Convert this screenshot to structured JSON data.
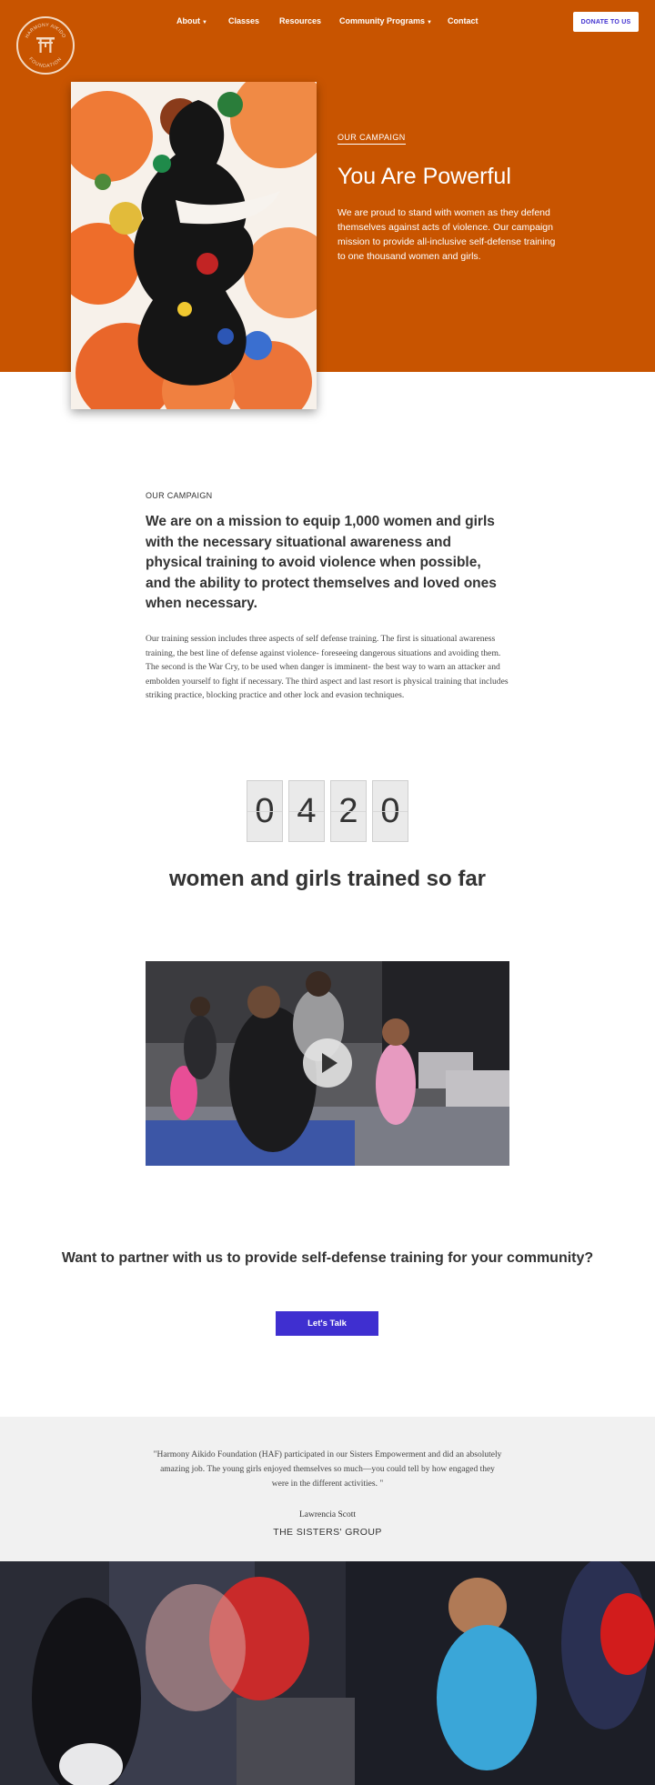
{
  "logo": {
    "text_top": "HARMONY AIKIDO",
    "text_bottom": "FOUNDATION"
  },
  "nav": {
    "items": [
      {
        "label": "About",
        "dropdown": true
      },
      {
        "label": "Classes",
        "dropdown": false
      },
      {
        "label": "Resources",
        "dropdown": false
      },
      {
        "label": "Community Programs",
        "dropdown": true
      },
      {
        "label": "Contact",
        "dropdown": false
      }
    ],
    "donate": "DONATE TO US"
  },
  "hero": {
    "eyebrow": "OUR CAMPAIGN",
    "title": "You Are Powerful",
    "description": "We are proud to stand with women as they defend themselves against acts of violence.  Our campaign mission to provide all-inclusive self-defense training to one thousand women and girls."
  },
  "campaign": {
    "label": "OUR CAMPAIGN",
    "mission": "We are on a mission to equip 1,000 women and girls with the necessary situational awareness and physical training to avoid violence when possible, and the ability to protect themselves and loved ones when necessary.",
    "body": "Our training session includes three aspects of self defense training. The first is situational awareness training, the best line of defense against violence- foreseeing dangerous situations and avoiding them. The second is the War Cry, to be used when danger is imminent- the best way to warn an attacker and embolden yourself to fight if necessary. The third aspect and last resort is physical training that includes striking practice, blocking practice and other lock and evasion techniques."
  },
  "counter": {
    "digits": [
      "0",
      "4",
      "2",
      "0"
    ],
    "caption": "women and girls trained so far"
  },
  "cta": {
    "title": "Want to partner with us to provide self-defense training for your community?",
    "button": "Let's Talk"
  },
  "testimonial": {
    "quote": "\"Harmony Aikido Foundation (HAF) participated in our Sisters Empowerment and did an absolutely amazing job. The young girls enjoyed themselves so much—you could tell by how engaged they were in the different activities. \"",
    "author": "Lawrencia Scott",
    "organization": "THE SISTERS' GROUP"
  },
  "colors": {
    "hero_bg": "#c85400",
    "accent": "#3f2fd0",
    "testimonial_bg": "#f1f1f1"
  }
}
